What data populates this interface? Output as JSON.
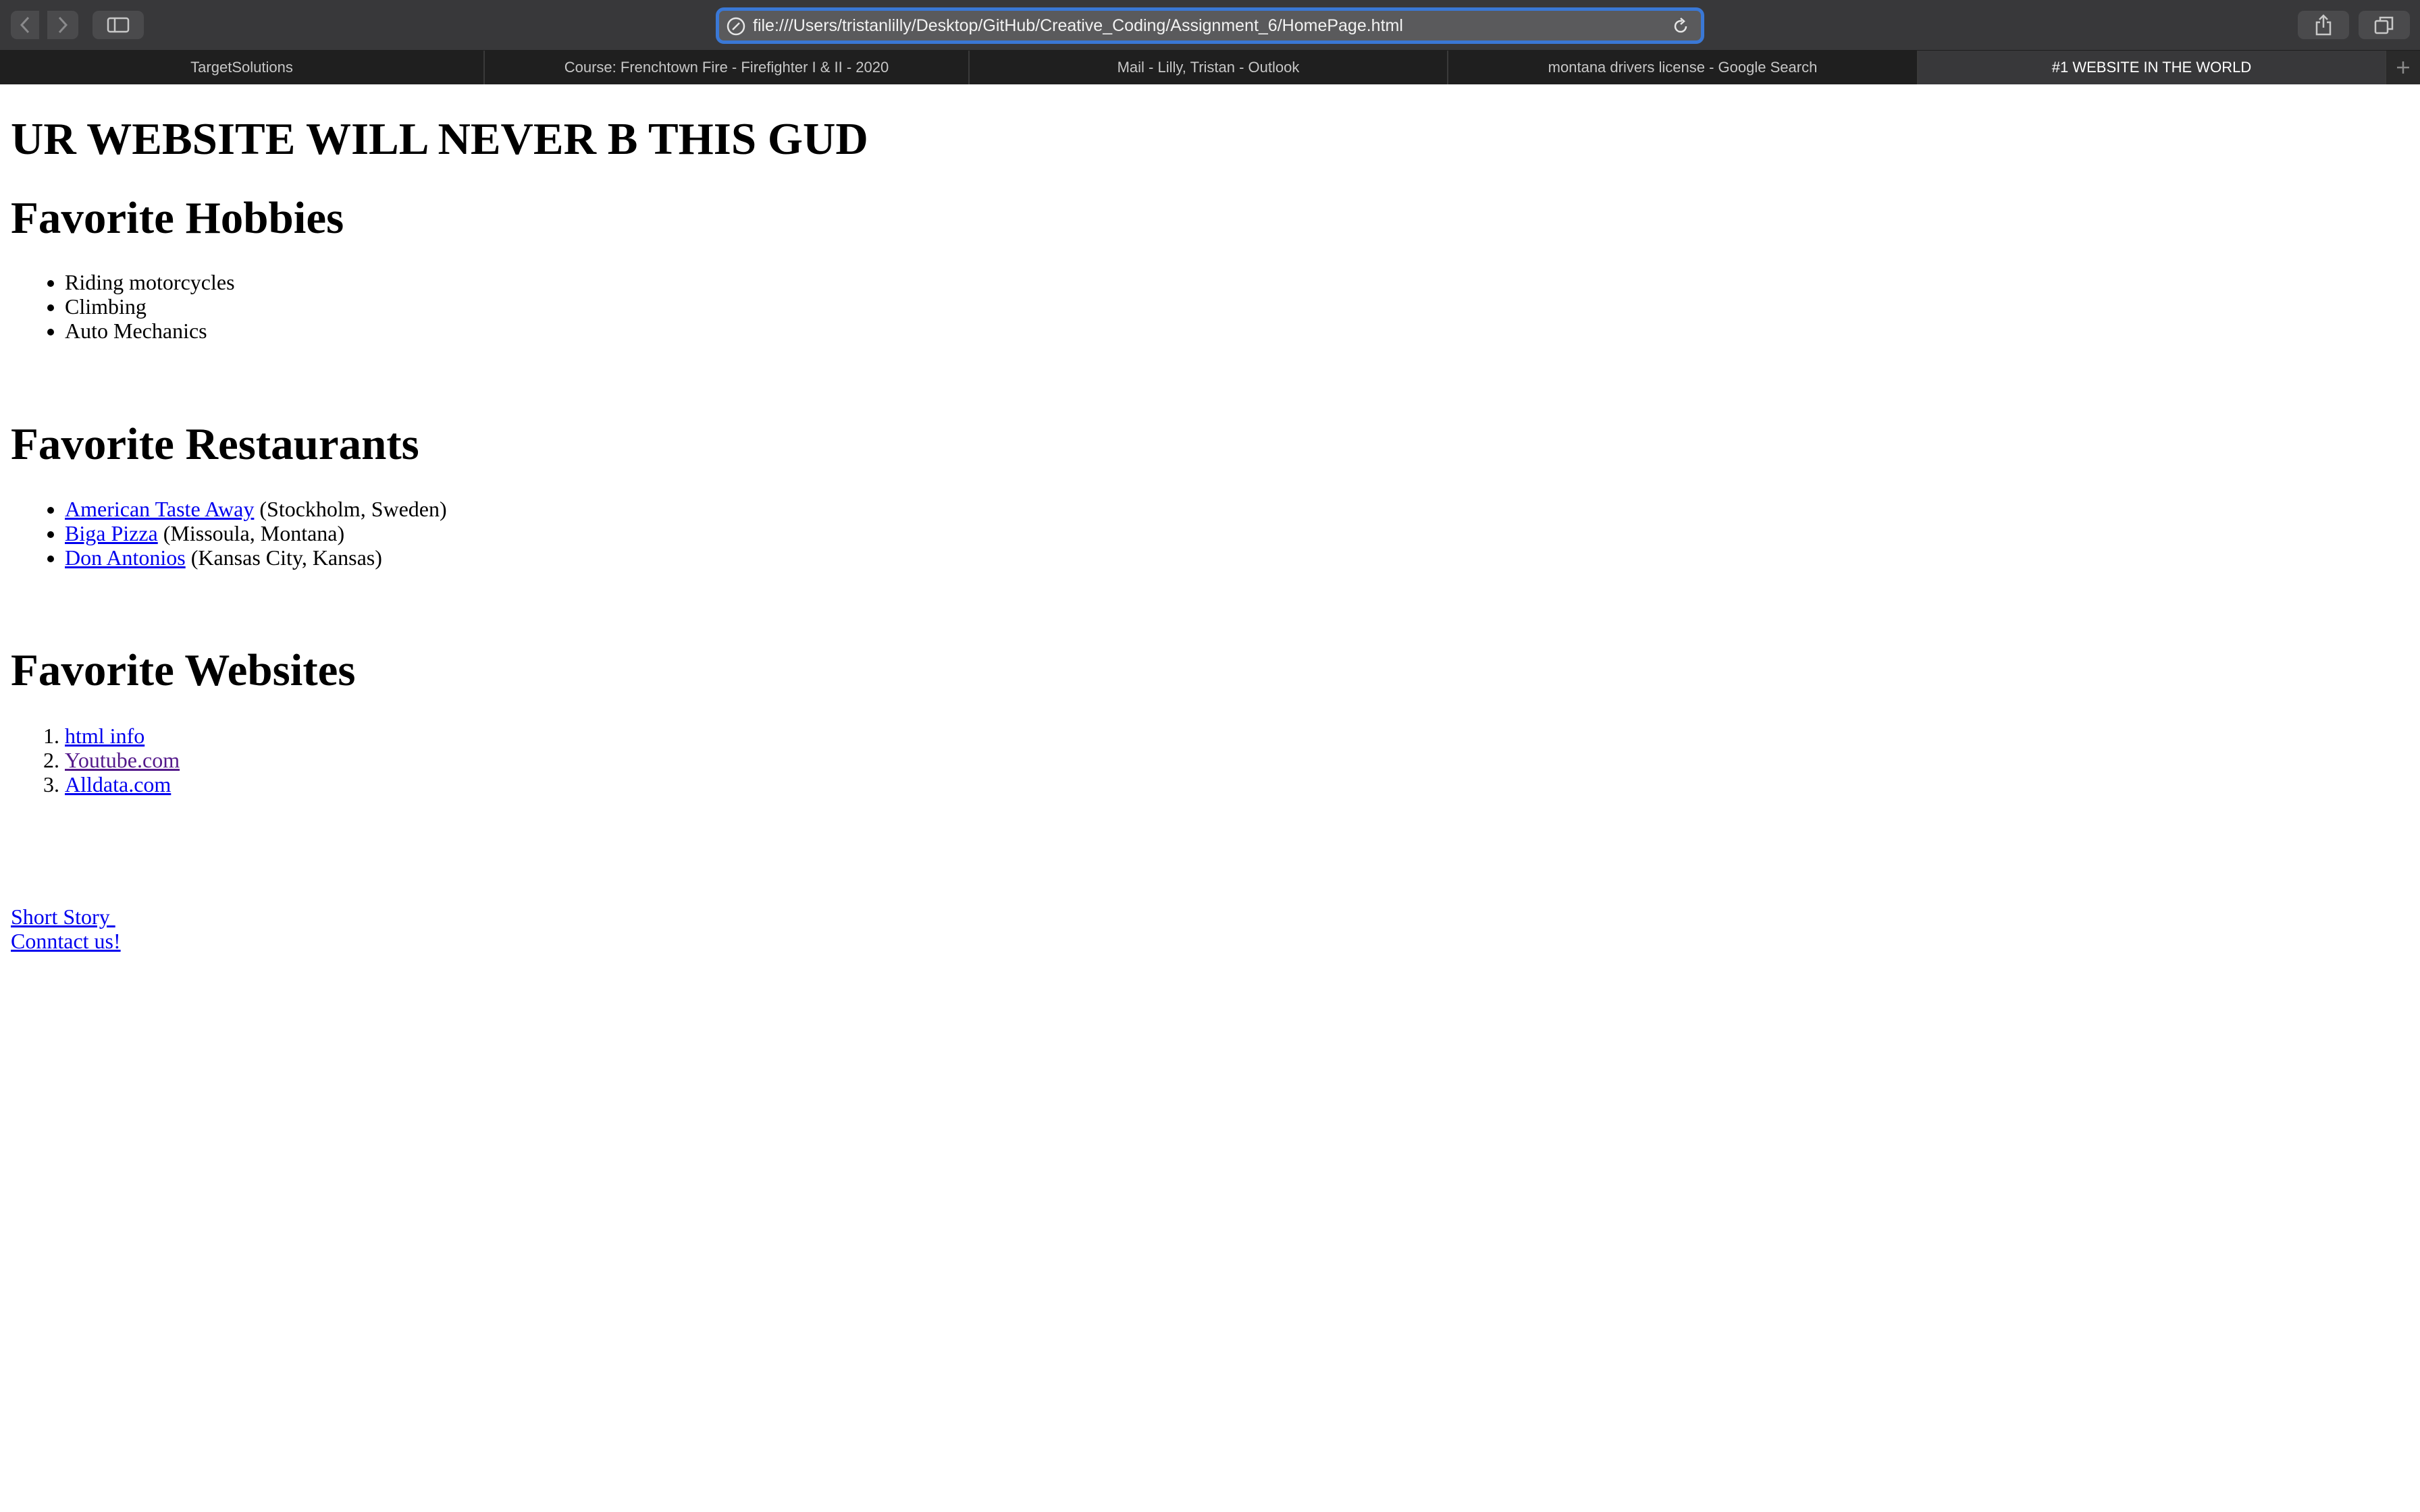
{
  "browser": {
    "url": "file:///Users/tristanlilly/Desktop/GitHub/Creative_Coding/Assignment_6/HomePage.html",
    "tabs": [
      {
        "label": "TargetSolutions"
      },
      {
        "label": "Course: Frenchtown Fire - Firefighter I & II - 2020"
      },
      {
        "label": "Mail - Lilly, Tristan - Outlook"
      },
      {
        "label": "montana drivers license - Google Search"
      },
      {
        "label": "#1 WEBSITE IN THE WORLD"
      }
    ]
  },
  "page": {
    "title": "UR WEBSITE WILL NEVER B THIS GUD",
    "hobbies": {
      "heading": "Favorite Hobbies",
      "items": [
        "Riding motorcycles",
        "Climbing",
        "Auto Mechanics"
      ]
    },
    "restaurants": {
      "heading": "Favorite Restaurants",
      "items": [
        {
          "name": "American Taste Away",
          "location": " (Stockholm, Sweden)"
        },
        {
          "name": "Biga Pizza",
          "location": " (Missoula, Montana)"
        },
        {
          "name": "Don Antonios",
          "location": " (Kansas City, Kansas)"
        }
      ]
    },
    "websites": {
      "heading": "Favorite Websites",
      "items": [
        "html info",
        "Youtube.com",
        "Alldata.com"
      ]
    },
    "links": {
      "short_story": "Short Story ",
      "contact": "Conntact us!"
    }
  }
}
